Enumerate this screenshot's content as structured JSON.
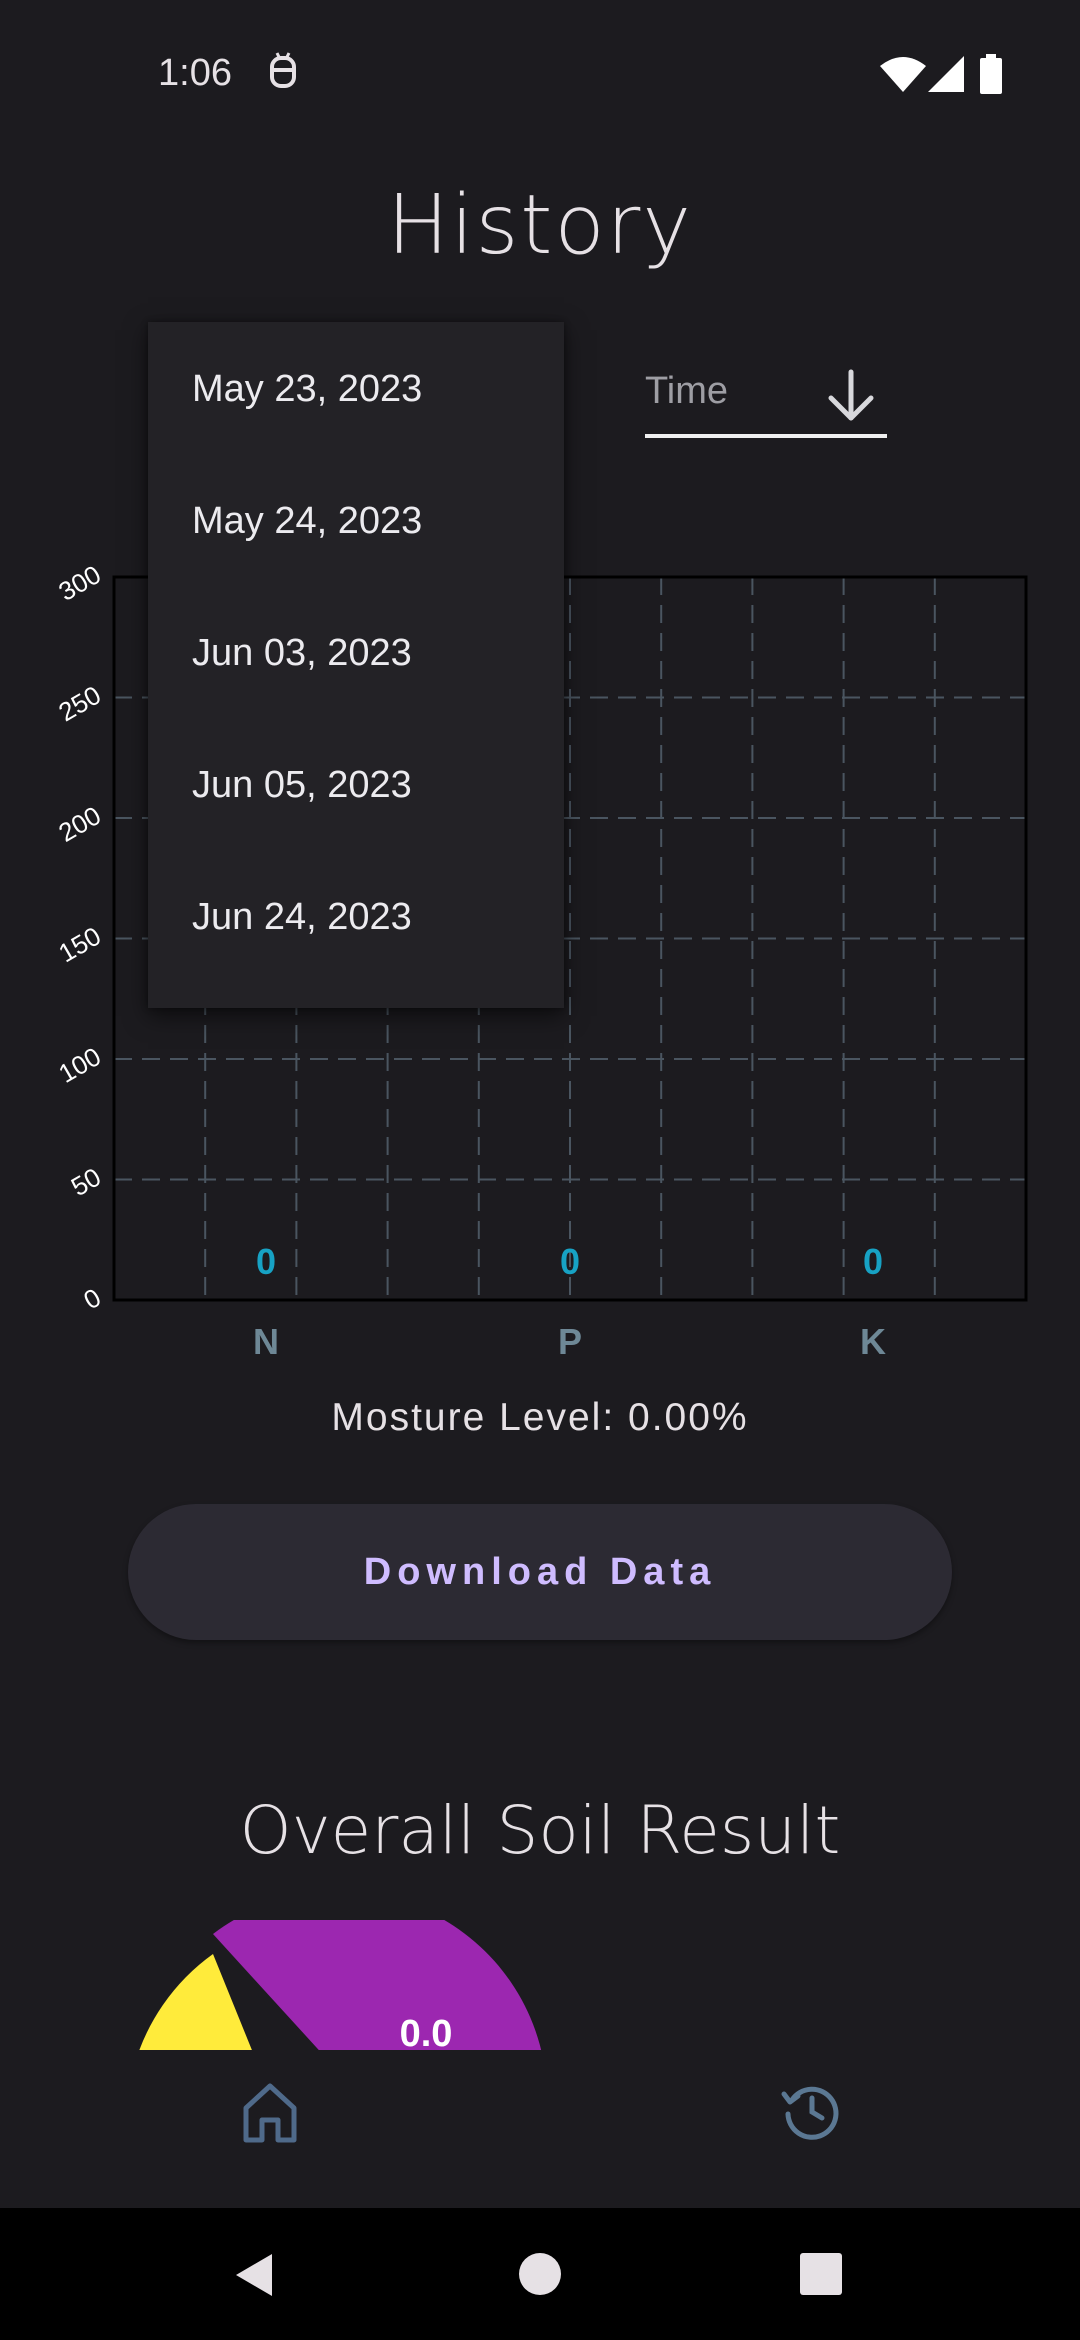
{
  "status_bar": {
    "time": "1:06"
  },
  "header": {
    "title": "History"
  },
  "time_select": {
    "label": "Time"
  },
  "dropdown": {
    "options": [
      "May 23, 2023",
      "May 24, 2023",
      "Jun 03, 2023",
      "Jun 05, 2023",
      "Jun 24, 2023"
    ]
  },
  "chart_data": {
    "type": "bar",
    "categories": [
      "N",
      "P",
      "K"
    ],
    "values": [
      0,
      0,
      0
    ],
    "data_labels": [
      "0",
      "0",
      "0"
    ],
    "ylim": [
      0,
      300
    ],
    "yticks": [
      "0",
      "50",
      "100",
      "150",
      "200",
      "250",
      "300"
    ],
    "grid": true,
    "value_label_color": "#17a2c4",
    "category_label_color": "#6e8896"
  },
  "moisture": {
    "text": "Mosture Level: 0.00%"
  },
  "actions": {
    "download_label": "Download Data"
  },
  "soil_result": {
    "title": "Overall Soil Result",
    "gauge_value": "0.0",
    "colors": {
      "yellow": "#ffeb3b",
      "purple": "#9c27b0"
    }
  },
  "bottom_nav": {
    "items": [
      "home-icon",
      "history-icon"
    ]
  }
}
